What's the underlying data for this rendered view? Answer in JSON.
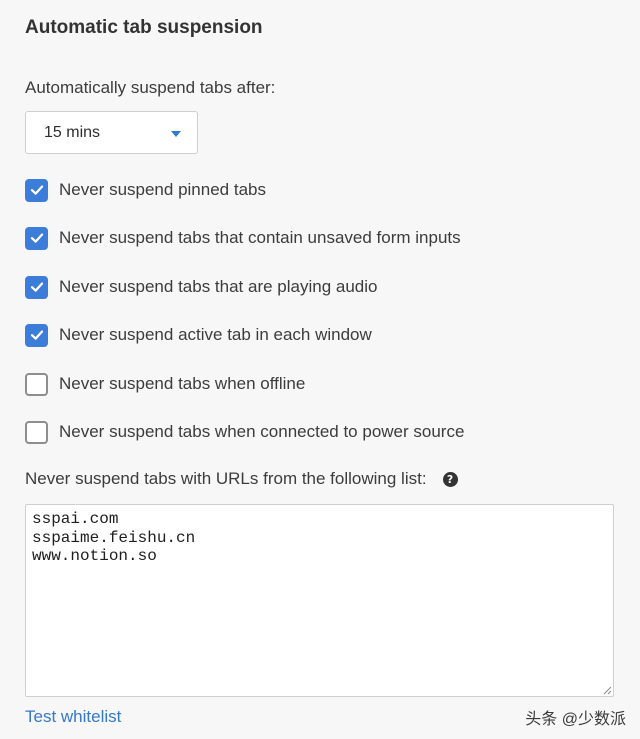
{
  "section": {
    "title": "Automatic tab suspension"
  },
  "suspend_after": {
    "label": "Automatically suspend tabs after:",
    "selected": "15 mins"
  },
  "options": [
    {
      "label": "Never suspend pinned tabs",
      "checked": true
    },
    {
      "label": "Never suspend tabs that contain unsaved form inputs",
      "checked": true
    },
    {
      "label": "Never suspend tabs that are playing audio",
      "checked": true
    },
    {
      "label": "Never suspend active tab in each window",
      "checked": true
    },
    {
      "label": "Never suspend tabs when offline",
      "checked": false
    },
    {
      "label": "Never suspend tabs when connected to power source",
      "checked": false
    }
  ],
  "whitelist": {
    "label": "Never suspend tabs with URLs from the following list:",
    "help_icon": "question-circle-icon",
    "value": "sspai.com\nsspaime.feishu.cn\nwww.notion.so",
    "test_link": "Test whitelist"
  },
  "watermark": "头条 @少数派",
  "colors": {
    "accent": "#3b7dd8",
    "link": "#3579c8",
    "background": "#f7f7f8"
  }
}
